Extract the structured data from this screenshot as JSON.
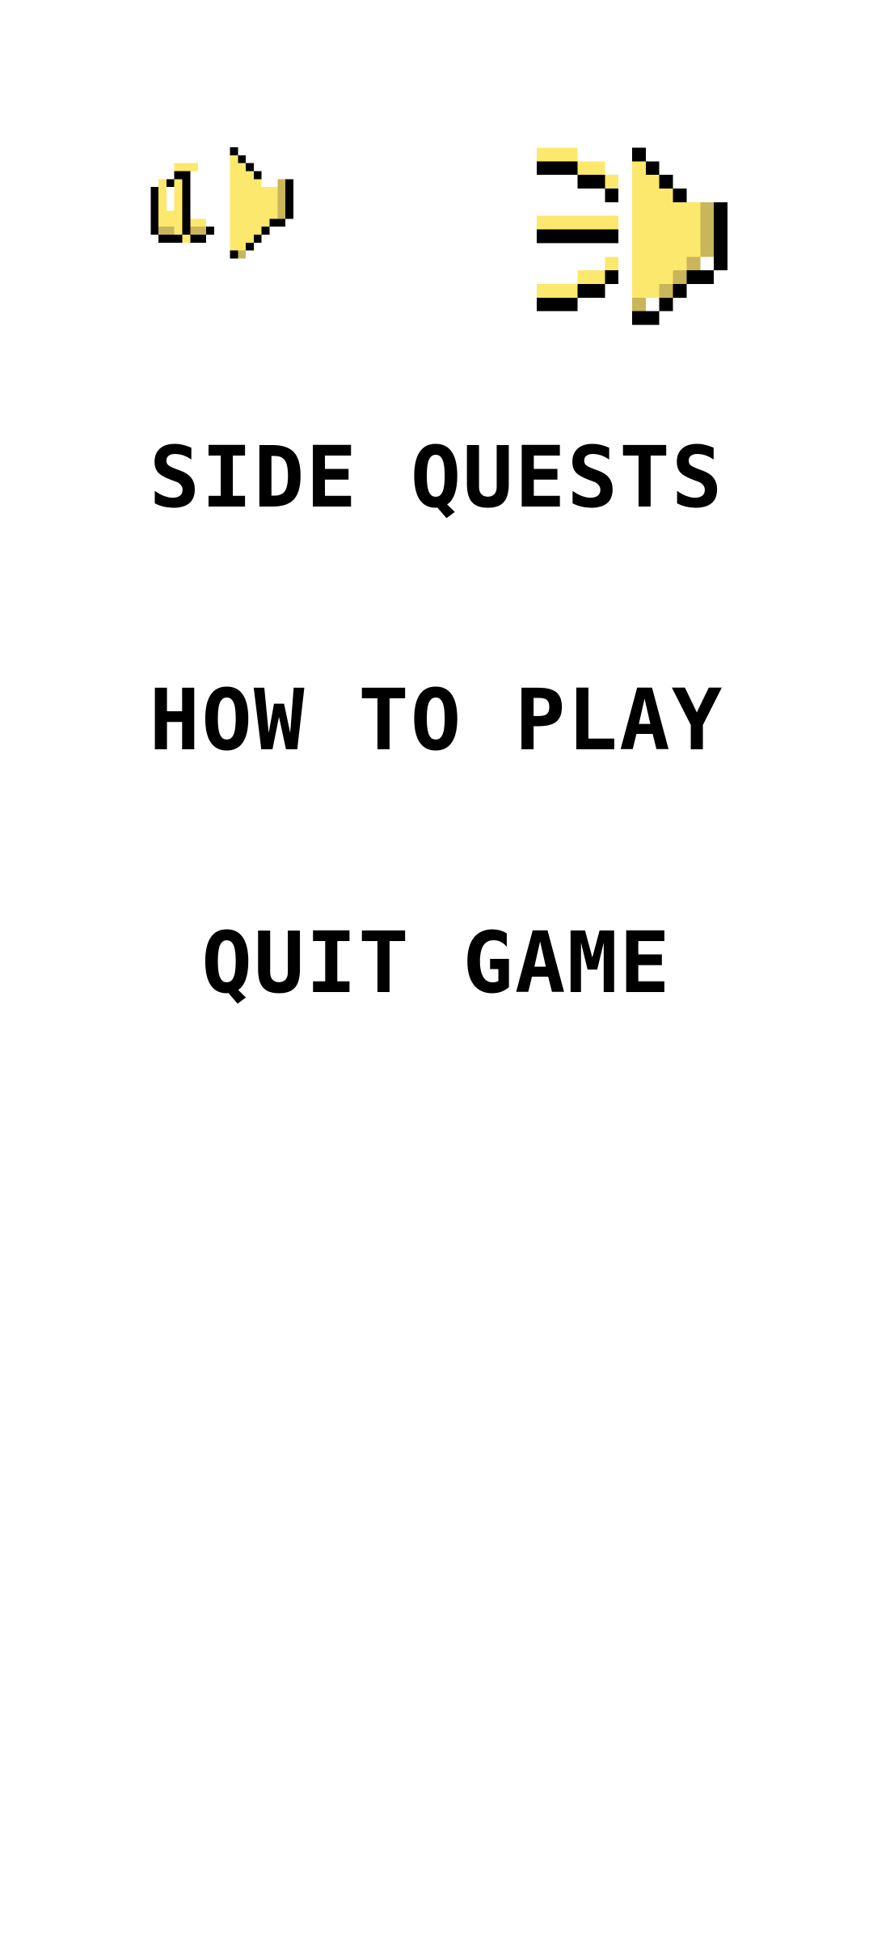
{
  "audio_controls": {
    "music_icon": "music-note-speaker-icon",
    "sound_icon": "speaker-sound-waves-icon",
    "icon_fill": "#FCE86C",
    "icon_shade": "#C9B55A",
    "icon_outline": "#000000"
  },
  "menu": {
    "items": [
      {
        "label": "SIDE QUESTS"
      },
      {
        "label": "HOW TO PLAY"
      },
      {
        "label": "QUIT GAME"
      }
    ]
  },
  "background_color": "#FFFFFF",
  "text_color": "#000000"
}
